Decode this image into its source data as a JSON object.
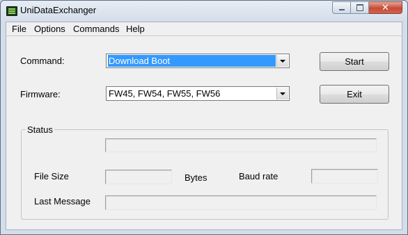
{
  "window": {
    "title": "UniDataExchanger",
    "icon": "app-icon",
    "controls": {
      "minimize": "minimize-icon",
      "maximize": "maximize-icon",
      "close": "✕"
    }
  },
  "menu": {
    "file": "File",
    "options": "Options",
    "commands": "Commands",
    "help": "Help"
  },
  "form": {
    "command_label": "Command:",
    "command_value": "Download Boot",
    "firmware_label": "Firmware:",
    "firmware_value": "FW45, FW54, FW55, FW56",
    "start_button": "Start",
    "exit_button": "Exit"
  },
  "status": {
    "group_title": "Status",
    "progress_value": "",
    "file_size_label": "File Size",
    "file_size_value": "",
    "bytes_label": "Bytes",
    "baud_rate_label": "Baud rate",
    "baud_rate_value": "",
    "last_message_label": "Last Message",
    "last_message_value": ""
  },
  "colors": {
    "selection": "#3399ff",
    "close_button": "#c74a36",
    "client_bg": "#f0f0f0"
  }
}
